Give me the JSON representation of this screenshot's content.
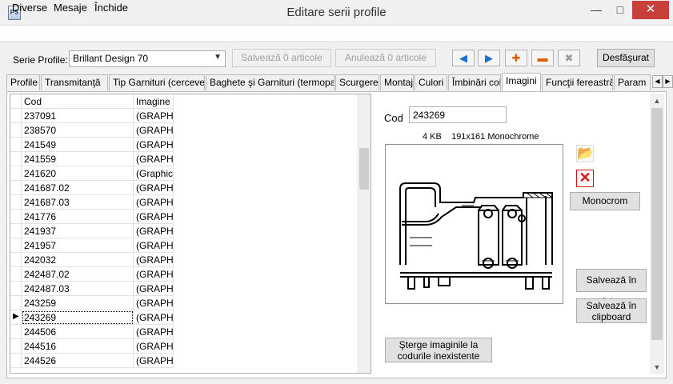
{
  "window": {
    "title": "Editare serii profile",
    "icon_text": "PS",
    "minimize_glyph": "—",
    "maximize_glyph": "□",
    "close_glyph": "✕"
  },
  "menu": [
    "Diverse",
    "Mesaje",
    "Închide"
  ],
  "toolbar": {
    "serie_label": "Serie Profile:",
    "serie_value": "Brillant Design 70",
    "save_label": "Salvează 0 articole",
    "cancel_label": "Anulează 0 articole",
    "expand_label": "Desfăşurat",
    "icons": {
      "prev": "◀",
      "next": "▶",
      "add": "✚",
      "remove": "▬",
      "delete": "✖"
    }
  },
  "tabs": [
    "Profile",
    "Transmitanţă",
    "Tip Garnituri (cercevea)",
    "Baghete şi Garnituri (termopan)",
    "Scurgere",
    "Montaj",
    "Culori",
    "Îmbinări colţ",
    "Imagini",
    "Funcţii fereastră",
    "Param"
  ],
  "active_tab": "Imagini",
  "grid": {
    "columns": [
      "Cod",
      "Imagine"
    ],
    "rows": [
      [
        "237091",
        "(GRAPHIC"
      ],
      [
        "238570",
        "(GRAPHIC"
      ],
      [
        "241549",
        "(GRAPHIC"
      ],
      [
        "241559",
        "(GRAPHIC"
      ],
      [
        "241620",
        "(Graphic)"
      ],
      [
        "241687.02",
        "(GRAPHIC"
      ],
      [
        "241687.03",
        "(GRAPHIC"
      ],
      [
        "241776",
        "(GRAPHIC"
      ],
      [
        "241937",
        "(GRAPHIC"
      ],
      [
        "241957",
        "(GRAPHIC"
      ],
      [
        "242032",
        "(GRAPHIC"
      ],
      [
        "242487.02",
        "(GRAPHIC"
      ],
      [
        "242487.03",
        "(GRAPHIC"
      ],
      [
        "243259",
        "(GRAPHIC"
      ],
      [
        "243269",
        "(GRAPHIC"
      ],
      [
        "244506",
        "(GRAPHIC"
      ],
      [
        "244516",
        "(GRAPHIC"
      ],
      [
        "244526",
        "(GRAPHIC"
      ]
    ],
    "selected_row": 14
  },
  "detail": {
    "cod_label": "Cod",
    "cod_value": "243269",
    "image_info": "4 KB    191x161 Monochrome",
    "monochrome_label": "Monocrom",
    "save_file_label": "Salvează în fişier",
    "save_clipboard_label": "Salvează în clipboard",
    "delete_images_label": "Şterge imaginile la codurile inexistente"
  }
}
